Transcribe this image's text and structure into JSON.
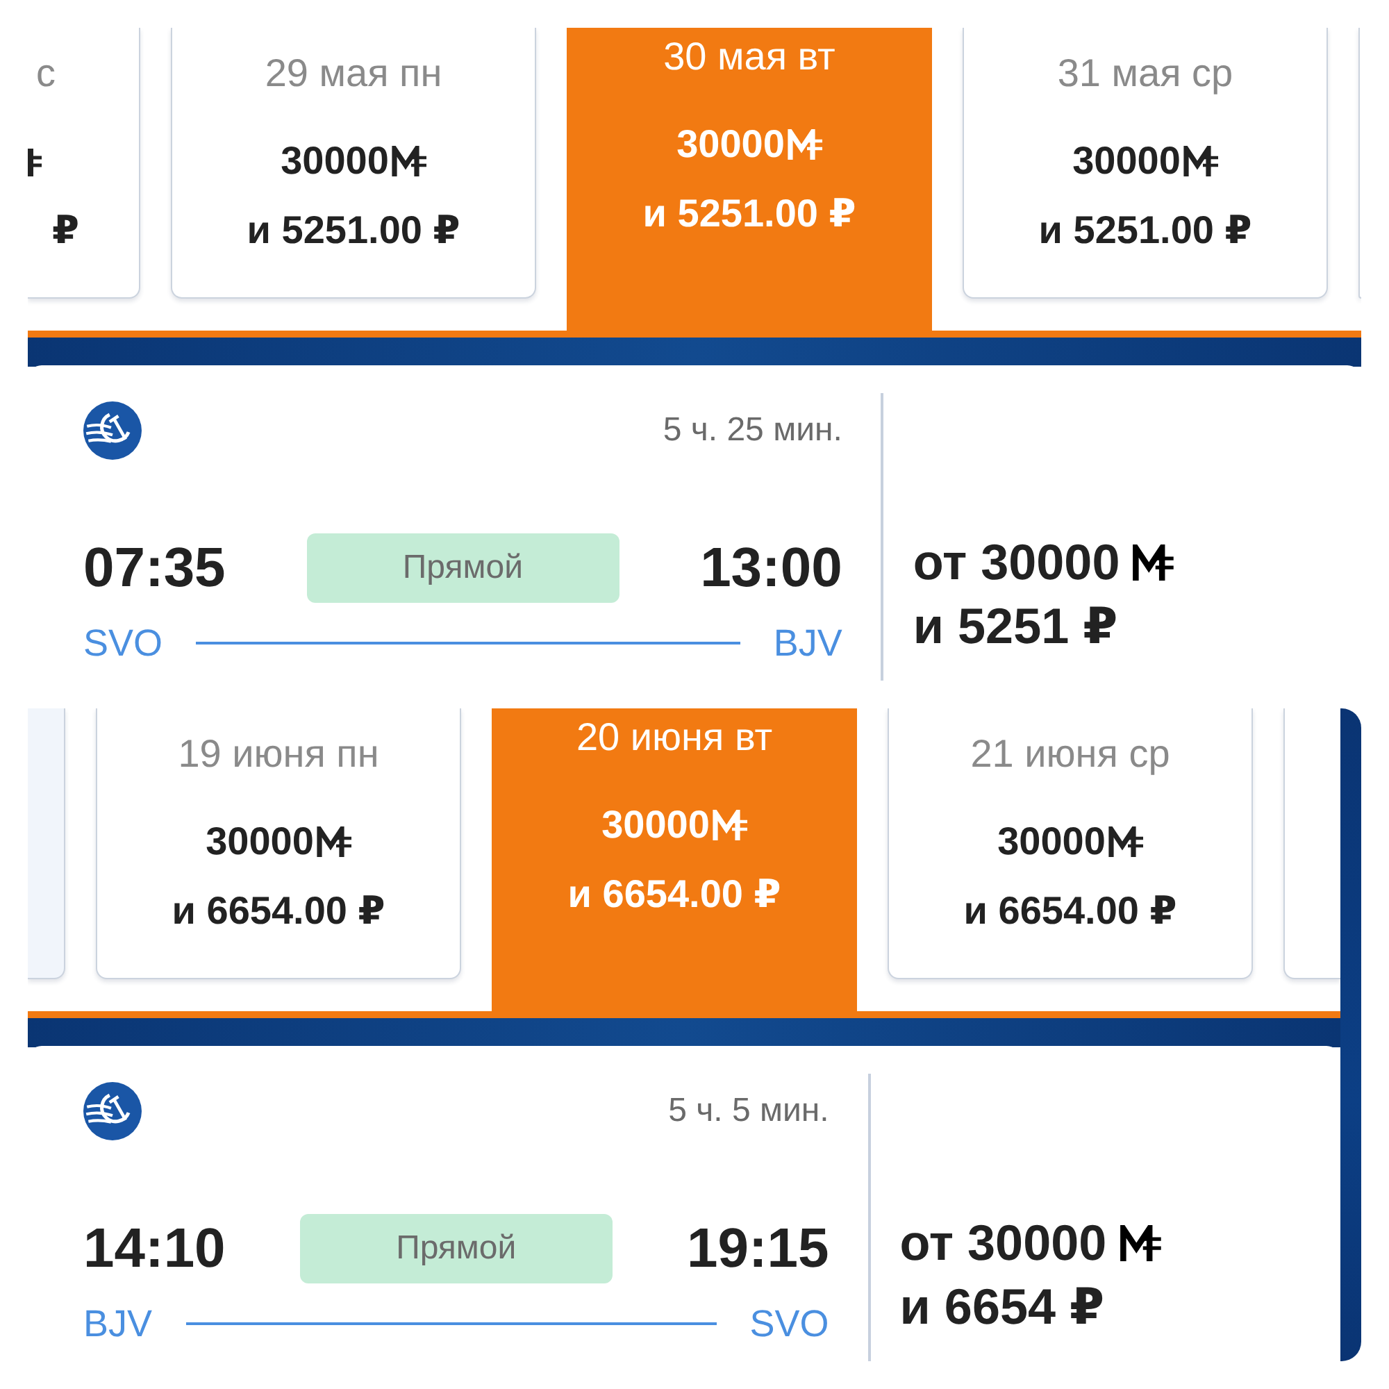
{
  "screens": [
    {
      "frame_edge": false,
      "dates": [
        {
          "kind": "cut",
          "date": "с",
          "rubles": "₽",
          "selected": false
        },
        {
          "kind": "full",
          "date": "29 мая пн",
          "miles": "30000",
          "rubles": "и 5251.00 ₽",
          "selected": false
        },
        {
          "kind": "full",
          "date": "30 мая вт",
          "miles": "30000",
          "rubles": "и 5251.00 ₽",
          "selected": true
        },
        {
          "kind": "full",
          "date": "31 мая ср",
          "miles": "30000",
          "rubles": "и 5251.00 ₽",
          "selected": false
        },
        {
          "kind": "edge",
          "selected": false
        }
      ],
      "flight": {
        "duration": "5 ч. 25 мин.",
        "departure": {
          "time": "07:35",
          "airport": "SVO"
        },
        "type": "Прямой",
        "arrival": {
          "time": "13:00",
          "airport": "BJV"
        },
        "price": {
          "miles": "от 30000",
          "rubles": "и 5251 ₽"
        }
      }
    },
    {
      "frame_edge": true,
      "dates": [
        {
          "kind": "edge",
          "selected": false
        },
        {
          "kind": "full",
          "date": "19 июня пн",
          "miles": "30000",
          "rubles": "и 6654.00 ₽",
          "selected": false
        },
        {
          "kind": "full",
          "date": "20 июня вт",
          "miles": "30000",
          "rubles": "и 6654.00 ₽",
          "selected": true
        },
        {
          "kind": "full",
          "date": "21 июня ср",
          "miles": "30000",
          "rubles": "и 6654.00 ₽",
          "selected": false
        },
        {
          "kind": "edge",
          "selected": false
        }
      ],
      "flight": {
        "duration": "5 ч. 5 мин.",
        "departure": {
          "time": "14:10",
          "airport": "BJV"
        },
        "type": "Прямой",
        "arrival": {
          "time": "19:15",
          "airport": "SVO"
        },
        "price": {
          "miles": "от 30000",
          "rubles": "и 6654 ₽"
        }
      }
    }
  ]
}
